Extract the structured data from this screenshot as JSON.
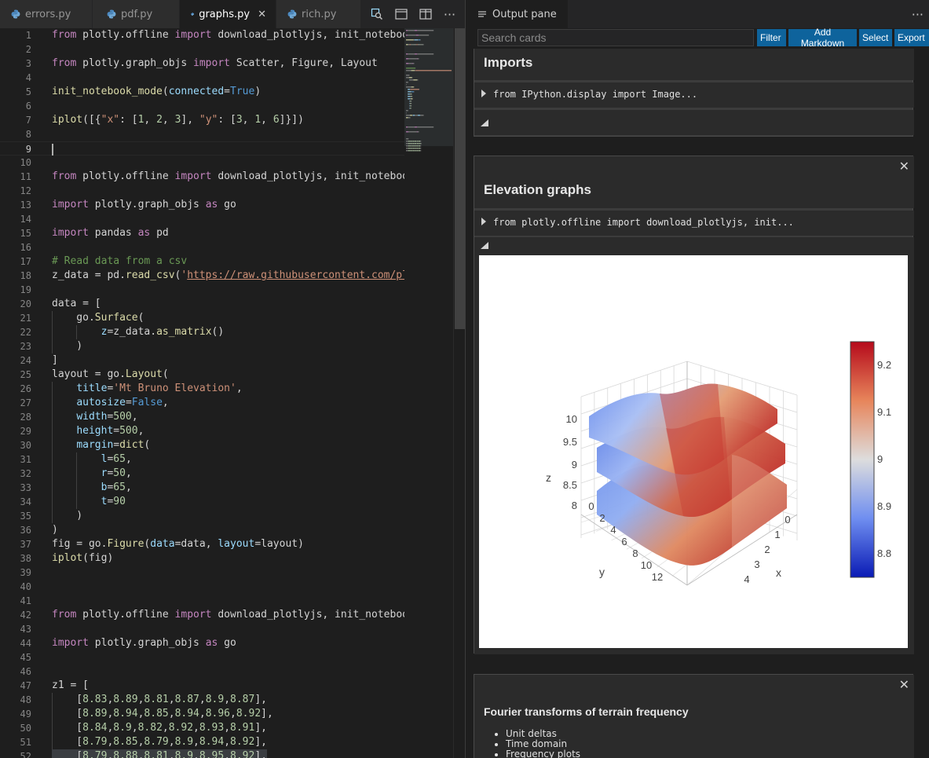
{
  "editor": {
    "tabs": [
      {
        "label": "errors.py",
        "active": false
      },
      {
        "label": "pdf.py",
        "active": false
      },
      {
        "label": "graphs.py",
        "active": true
      },
      {
        "label": "rich.py",
        "active": false
      }
    ],
    "current_line": 9,
    "lines": [
      {
        "n": 1,
        "tokens": [
          [
            "kw",
            "from"
          ],
          [
            "tx",
            " plotly.offline "
          ],
          [
            "kw",
            "import"
          ],
          [
            "tx",
            " download_plotlyjs, init_notebook_mode"
          ]
        ]
      },
      {
        "n": 2,
        "tokens": []
      },
      {
        "n": 3,
        "tokens": [
          [
            "kw",
            "from"
          ],
          [
            "tx",
            " plotly.graph_objs "
          ],
          [
            "kw",
            "import"
          ],
          [
            "tx",
            " Scatter, Figure, Layout"
          ]
        ]
      },
      {
        "n": 4,
        "tokens": []
      },
      {
        "n": 5,
        "tokens": [
          [
            "fn",
            "init_notebook_mode"
          ],
          [
            "tx",
            "("
          ],
          [
            "pa",
            "connected"
          ],
          [
            "tx",
            "="
          ],
          [
            "bl",
            "True"
          ],
          [
            "tx",
            ")"
          ]
        ]
      },
      {
        "n": 6,
        "tokens": []
      },
      {
        "n": 7,
        "tokens": [
          [
            "fn",
            "iplot"
          ],
          [
            "tx",
            "([{"
          ],
          [
            "st",
            "\"x\""
          ],
          [
            "tx",
            ": ["
          ],
          [
            "nu",
            "1"
          ],
          [
            "tx",
            ", "
          ],
          [
            "nu",
            "2"
          ],
          [
            "tx",
            ", "
          ],
          [
            "nu",
            "3"
          ],
          [
            "tx",
            "], "
          ],
          [
            "st",
            "\"y\""
          ],
          [
            "tx",
            ": ["
          ],
          [
            "nu",
            "3"
          ],
          [
            "tx",
            ", "
          ],
          [
            "nu",
            "1"
          ],
          [
            "tx",
            ", "
          ],
          [
            "nu",
            "6"
          ],
          [
            "tx",
            "]}])"
          ]
        ]
      },
      {
        "n": 8,
        "tokens": []
      },
      {
        "n": 9,
        "tokens": []
      },
      {
        "n": 10,
        "tokens": []
      },
      {
        "n": 11,
        "tokens": [
          [
            "kw",
            "from"
          ],
          [
            "tx",
            " plotly.offline "
          ],
          [
            "kw",
            "import"
          ],
          [
            "tx",
            " download_plotlyjs, init_notebook_mode"
          ]
        ]
      },
      {
        "n": 12,
        "tokens": []
      },
      {
        "n": 13,
        "tokens": [
          [
            "kw",
            "import"
          ],
          [
            "tx",
            " plotly.graph_objs "
          ],
          [
            "kw",
            "as"
          ],
          [
            "tx",
            " go"
          ]
        ]
      },
      {
        "n": 14,
        "tokens": []
      },
      {
        "n": 15,
        "tokens": [
          [
            "kw",
            "import"
          ],
          [
            "tx",
            " pandas "
          ],
          [
            "kw",
            "as"
          ],
          [
            "tx",
            " pd"
          ]
        ]
      },
      {
        "n": 16,
        "tokens": []
      },
      {
        "n": 17,
        "tokens": [
          [
            "co",
            "# Read data from a csv"
          ]
        ]
      },
      {
        "n": 18,
        "tokens": [
          [
            "tx",
            "z_data = pd."
          ],
          [
            "fn",
            "read_csv"
          ],
          [
            "tx",
            "("
          ],
          [
            "st",
            "'"
          ],
          [
            "ul",
            "https://raw.githubusercontent.com/plotly/datasets/master/api_docs/mt_bruno_elevation.csv"
          ],
          [
            "st",
            "'"
          ],
          [
            "tx",
            ")"
          ]
        ]
      },
      {
        "n": 19,
        "tokens": []
      },
      {
        "n": 20,
        "tokens": [
          [
            "tx",
            "data = ["
          ]
        ]
      },
      {
        "n": 21,
        "tokens": [
          [
            "tx",
            "    go."
          ],
          [
            "fn",
            "Surface"
          ],
          [
            "tx",
            "("
          ]
        ]
      },
      {
        "n": 22,
        "tokens": [
          [
            "tx",
            "        "
          ],
          [
            "pa",
            "z"
          ],
          [
            "tx",
            "=z_data."
          ],
          [
            "fn",
            "as_matrix"
          ],
          [
            "tx",
            "()"
          ]
        ]
      },
      {
        "n": 23,
        "tokens": [
          [
            "tx",
            "    )"
          ]
        ]
      },
      {
        "n": 24,
        "tokens": [
          [
            "tx",
            "]"
          ]
        ]
      },
      {
        "n": 25,
        "tokens": [
          [
            "tx",
            "layout = go."
          ],
          [
            "fn",
            "Layout"
          ],
          [
            "tx",
            "("
          ]
        ]
      },
      {
        "n": 26,
        "tokens": [
          [
            "tx",
            "    "
          ],
          [
            "pa",
            "title"
          ],
          [
            "tx",
            "="
          ],
          [
            "st",
            "'Mt Bruno Elevation'"
          ],
          [
            "tx",
            ","
          ]
        ]
      },
      {
        "n": 27,
        "tokens": [
          [
            "tx",
            "    "
          ],
          [
            "pa",
            "autosize"
          ],
          [
            "tx",
            "="
          ],
          [
            "bl",
            "False"
          ],
          [
            "tx",
            ","
          ]
        ]
      },
      {
        "n": 28,
        "tokens": [
          [
            "tx",
            "    "
          ],
          [
            "pa",
            "width"
          ],
          [
            "tx",
            "="
          ],
          [
            "nu",
            "500"
          ],
          [
            "tx",
            ","
          ]
        ]
      },
      {
        "n": 29,
        "tokens": [
          [
            "tx",
            "    "
          ],
          [
            "pa",
            "height"
          ],
          [
            "tx",
            "="
          ],
          [
            "nu",
            "500"
          ],
          [
            "tx",
            ","
          ]
        ]
      },
      {
        "n": 30,
        "tokens": [
          [
            "tx",
            "    "
          ],
          [
            "pa",
            "margin"
          ],
          [
            "tx",
            "="
          ],
          [
            "fn",
            "dict"
          ],
          [
            "tx",
            "("
          ]
        ]
      },
      {
        "n": 31,
        "tokens": [
          [
            "tx",
            "        "
          ],
          [
            "pa",
            "l"
          ],
          [
            "tx",
            "="
          ],
          [
            "nu",
            "65"
          ],
          [
            "tx",
            ","
          ]
        ]
      },
      {
        "n": 32,
        "tokens": [
          [
            "tx",
            "        "
          ],
          [
            "pa",
            "r"
          ],
          [
            "tx",
            "="
          ],
          [
            "nu",
            "50"
          ],
          [
            "tx",
            ","
          ]
        ]
      },
      {
        "n": 33,
        "tokens": [
          [
            "tx",
            "        "
          ],
          [
            "pa",
            "b"
          ],
          [
            "tx",
            "="
          ],
          [
            "nu",
            "65"
          ],
          [
            "tx",
            ","
          ]
        ]
      },
      {
        "n": 34,
        "tokens": [
          [
            "tx",
            "        "
          ],
          [
            "pa",
            "t"
          ],
          [
            "tx",
            "="
          ],
          [
            "nu",
            "90"
          ]
        ]
      },
      {
        "n": 35,
        "tokens": [
          [
            "tx",
            "    )"
          ]
        ]
      },
      {
        "n": 36,
        "tokens": [
          [
            "tx",
            ")"
          ]
        ]
      },
      {
        "n": 37,
        "tokens": [
          [
            "tx",
            "fig = go."
          ],
          [
            "fn",
            "Figure"
          ],
          [
            "tx",
            "("
          ],
          [
            "pa",
            "data"
          ],
          [
            "tx",
            "=data, "
          ],
          [
            "pa",
            "layout"
          ],
          [
            "tx",
            "=layout)"
          ]
        ]
      },
      {
        "n": 38,
        "tokens": [
          [
            "fn",
            "iplot"
          ],
          [
            "tx",
            "(fig)"
          ]
        ]
      },
      {
        "n": 39,
        "tokens": []
      },
      {
        "n": 40,
        "tokens": []
      },
      {
        "n": 41,
        "tokens": []
      },
      {
        "n": 42,
        "tokens": [
          [
            "kw",
            "from"
          ],
          [
            "tx",
            " plotly.offline "
          ],
          [
            "kw",
            "import"
          ],
          [
            "tx",
            " download_plotlyjs, init_notebook_mode"
          ]
        ]
      },
      {
        "n": 43,
        "tokens": []
      },
      {
        "n": 44,
        "tokens": [
          [
            "kw",
            "import"
          ],
          [
            "tx",
            " plotly.graph_objs "
          ],
          [
            "kw",
            "as"
          ],
          [
            "tx",
            " go"
          ]
        ]
      },
      {
        "n": 45,
        "tokens": []
      },
      {
        "n": 46,
        "tokens": []
      },
      {
        "n": 47,
        "tokens": [
          [
            "tx",
            "z1 = ["
          ]
        ]
      },
      {
        "n": 48,
        "tokens": [
          [
            "tx",
            "    ["
          ],
          [
            "nu",
            "8.83"
          ],
          [
            "tx",
            ","
          ],
          [
            "nu",
            "8.89"
          ],
          [
            "tx",
            ","
          ],
          [
            "nu",
            "8.81"
          ],
          [
            "tx",
            ","
          ],
          [
            "nu",
            "8.87"
          ],
          [
            "tx",
            ","
          ],
          [
            "nu",
            "8.9"
          ],
          [
            "tx",
            ","
          ],
          [
            "nu",
            "8.87"
          ],
          [
            "tx",
            "],"
          ]
        ]
      },
      {
        "n": 49,
        "tokens": [
          [
            "tx",
            "    ["
          ],
          [
            "nu",
            "8.89"
          ],
          [
            "tx",
            ","
          ],
          [
            "nu",
            "8.94"
          ],
          [
            "tx",
            ","
          ],
          [
            "nu",
            "8.85"
          ],
          [
            "tx",
            ","
          ],
          [
            "nu",
            "8.94"
          ],
          [
            "tx",
            ","
          ],
          [
            "nu",
            "8.96"
          ],
          [
            "tx",
            ","
          ],
          [
            "nu",
            "8.92"
          ],
          [
            "tx",
            "],"
          ]
        ]
      },
      {
        "n": 50,
        "tokens": [
          [
            "tx",
            "    ["
          ],
          [
            "nu",
            "8.84"
          ],
          [
            "tx",
            ","
          ],
          [
            "nu",
            "8.9"
          ],
          [
            "tx",
            ","
          ],
          [
            "nu",
            "8.82"
          ],
          [
            "tx",
            ","
          ],
          [
            "nu",
            "8.92"
          ],
          [
            "tx",
            ","
          ],
          [
            "nu",
            "8.93"
          ],
          [
            "tx",
            ","
          ],
          [
            "nu",
            "8.91"
          ],
          [
            "tx",
            "],"
          ]
        ]
      },
      {
        "n": 51,
        "tokens": [
          [
            "tx",
            "    ["
          ],
          [
            "nu",
            "8.79"
          ],
          [
            "tx",
            ","
          ],
          [
            "nu",
            "8.85"
          ],
          [
            "tx",
            ","
          ],
          [
            "nu",
            "8.79"
          ],
          [
            "tx",
            ","
          ],
          [
            "nu",
            "8.9"
          ],
          [
            "tx",
            ","
          ],
          [
            "nu",
            "8.94"
          ],
          [
            "tx",
            ","
          ],
          [
            "nu",
            "8.92"
          ],
          [
            "tx",
            "],"
          ]
        ]
      },
      {
        "n": 52,
        "tokens": [
          [
            "tx",
            "    ["
          ],
          [
            "nu",
            "8.79"
          ],
          [
            "tx",
            ","
          ],
          [
            "nu",
            "8.88"
          ],
          [
            "tx",
            ","
          ],
          [
            "nu",
            "8.81"
          ],
          [
            "tx",
            ","
          ],
          [
            "nu",
            "8.9"
          ],
          [
            "tx",
            ","
          ],
          [
            "nu",
            "8.95"
          ],
          [
            "tx",
            ","
          ],
          [
            "nu",
            "8.92"
          ],
          [
            "tx",
            "],"
          ]
        ]
      }
    ],
    "selected_lines": [
      52
    ]
  },
  "output": {
    "tab_label": "Output pane",
    "search_placeholder": "Search cards",
    "buttons": {
      "filter": "Filter",
      "add_markdown": "Add Markdown",
      "select": "Select",
      "export": "Export"
    },
    "cards": {
      "imports": {
        "title": "Imports",
        "code": "from IPython.display import Image..."
      },
      "elevation": {
        "title": "Elevation graphs",
        "code": "from plotly.offline import download_plotlyjs, init..."
      },
      "fourier": {
        "title": "Fourier transforms of terrain frequency",
        "items": [
          "Unit deltas",
          "Time domain",
          "Frequency plots"
        ]
      }
    }
  },
  "chart_data": {
    "type": "surface",
    "z_axis": {
      "label": "z",
      "ticks": [
        "8",
        "8.5",
        "9",
        "9.5",
        "10"
      ]
    },
    "y_axis": {
      "label": "y",
      "ticks": [
        "0",
        "2",
        "4",
        "6",
        "8",
        "10",
        "12"
      ]
    },
    "x_axis": {
      "label": "x",
      "ticks": [
        "0",
        "1",
        "2",
        "3",
        "4"
      ]
    },
    "colorbar": {
      "ticks": [
        "8.8",
        "8.9",
        "9",
        "9.1",
        "9.2"
      ],
      "range": [
        8.75,
        9.25
      ],
      "colors": [
        "#0a1bb5",
        "#6f8ef0",
        "#dddddd",
        "#e7855b",
        "#b50a1b"
      ]
    },
    "surfaces": 3
  }
}
